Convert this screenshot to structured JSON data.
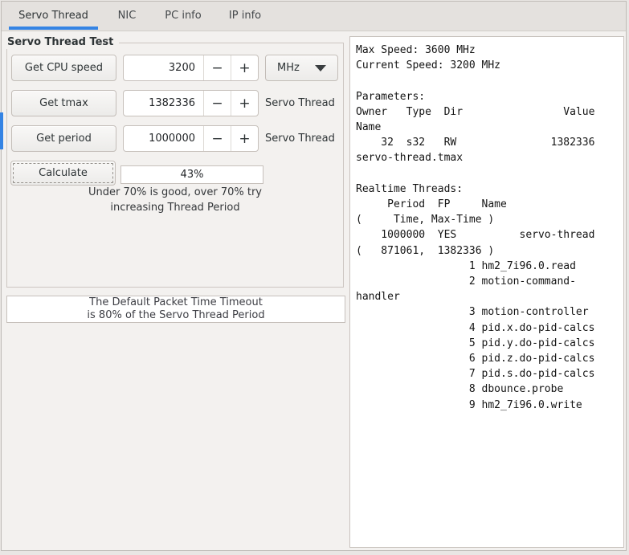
{
  "colors": {
    "accent": "#3584e4"
  },
  "tabs": {
    "items": [
      {
        "label": "Servo Thread",
        "active": true
      },
      {
        "label": "NIC",
        "active": false
      },
      {
        "label": "PC info",
        "active": false
      },
      {
        "label": "IP info",
        "active": false
      }
    ]
  },
  "panel": {
    "frame_title": "Servo Thread Test",
    "rows": [
      {
        "button": "Get CPU speed",
        "value": "3200",
        "unit": "MHz"
      },
      {
        "button": "Get tmax",
        "value": "1382336",
        "label": "Servo Thread"
      },
      {
        "button": "Get period",
        "value": "1000000",
        "label": "Servo Thread"
      }
    ],
    "spin": {
      "minus_label": "−",
      "plus_label": "+"
    },
    "calculate": {
      "button": "Calculate",
      "result": "43%"
    },
    "hint_line1": "Under 70% is good, over 70% try",
    "hint_line2": "increasing Thread Period",
    "note_line1": "The Default Packet Time Timeout",
    "note_line2": "is 80% of the Servo Thread Period"
  },
  "output": {
    "lines": [
      "Max Speed: 3600 MHz",
      "Current Speed: 3200 MHz",
      "",
      "Parameters:",
      "Owner   Type  Dir                Value",
      "Name",
      "    32  s32   RW               1382336",
      "servo-thread.tmax",
      "",
      "Realtime Threads:",
      "     Period  FP     Name",
      "(     Time, Max-Time )",
      "    1000000  YES          servo-thread",
      "(   871061,  1382336 )",
      "                  1 hm2_7i96.0.read",
      "                  2 motion-command-",
      "handler",
      "                  3 motion-controller",
      "                  4 pid.x.do-pid-calcs",
      "                  5 pid.y.do-pid-calcs",
      "                  6 pid.z.do-pid-calcs",
      "                  7 pid.s.do-pid-calcs",
      "                  8 dbounce.probe",
      "                  9 hm2_7i96.0.write"
    ]
  }
}
